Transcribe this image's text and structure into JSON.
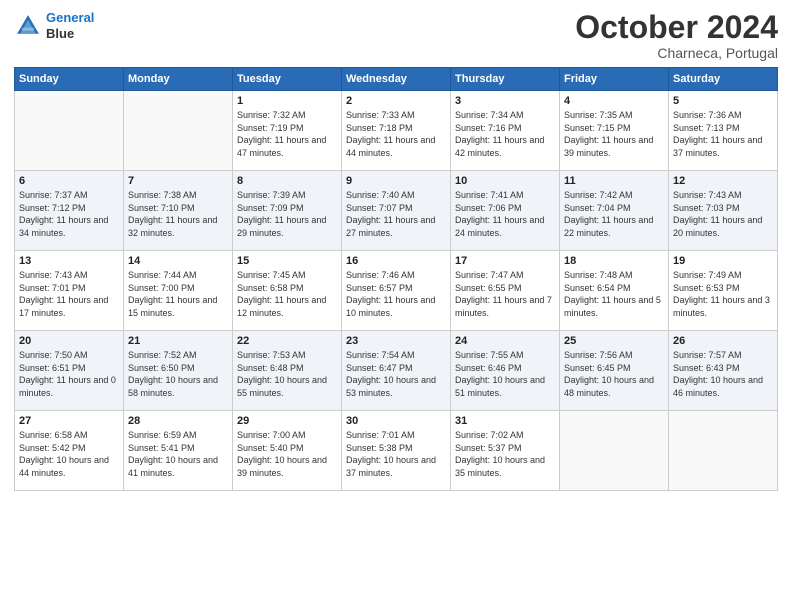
{
  "header": {
    "logo_line1": "General",
    "logo_line2": "Blue",
    "month": "October 2024",
    "location": "Charneca, Portugal"
  },
  "days_of_week": [
    "Sunday",
    "Monday",
    "Tuesday",
    "Wednesday",
    "Thursday",
    "Friday",
    "Saturday"
  ],
  "weeks": [
    [
      {
        "day": "",
        "sunrise": "",
        "sunset": "",
        "daylight": ""
      },
      {
        "day": "",
        "sunrise": "",
        "sunset": "",
        "daylight": ""
      },
      {
        "day": "1",
        "sunrise": "Sunrise: 7:32 AM",
        "sunset": "Sunset: 7:19 PM",
        "daylight": "Daylight: 11 hours and 47 minutes."
      },
      {
        "day": "2",
        "sunrise": "Sunrise: 7:33 AM",
        "sunset": "Sunset: 7:18 PM",
        "daylight": "Daylight: 11 hours and 44 minutes."
      },
      {
        "day": "3",
        "sunrise": "Sunrise: 7:34 AM",
        "sunset": "Sunset: 7:16 PM",
        "daylight": "Daylight: 11 hours and 42 minutes."
      },
      {
        "day": "4",
        "sunrise": "Sunrise: 7:35 AM",
        "sunset": "Sunset: 7:15 PM",
        "daylight": "Daylight: 11 hours and 39 minutes."
      },
      {
        "day": "5",
        "sunrise": "Sunrise: 7:36 AM",
        "sunset": "Sunset: 7:13 PM",
        "daylight": "Daylight: 11 hours and 37 minutes."
      }
    ],
    [
      {
        "day": "6",
        "sunrise": "Sunrise: 7:37 AM",
        "sunset": "Sunset: 7:12 PM",
        "daylight": "Daylight: 11 hours and 34 minutes."
      },
      {
        "day": "7",
        "sunrise": "Sunrise: 7:38 AM",
        "sunset": "Sunset: 7:10 PM",
        "daylight": "Daylight: 11 hours and 32 minutes."
      },
      {
        "day": "8",
        "sunrise": "Sunrise: 7:39 AM",
        "sunset": "Sunset: 7:09 PM",
        "daylight": "Daylight: 11 hours and 29 minutes."
      },
      {
        "day": "9",
        "sunrise": "Sunrise: 7:40 AM",
        "sunset": "Sunset: 7:07 PM",
        "daylight": "Daylight: 11 hours and 27 minutes."
      },
      {
        "day": "10",
        "sunrise": "Sunrise: 7:41 AM",
        "sunset": "Sunset: 7:06 PM",
        "daylight": "Daylight: 11 hours and 24 minutes."
      },
      {
        "day": "11",
        "sunrise": "Sunrise: 7:42 AM",
        "sunset": "Sunset: 7:04 PM",
        "daylight": "Daylight: 11 hours and 22 minutes."
      },
      {
        "day": "12",
        "sunrise": "Sunrise: 7:43 AM",
        "sunset": "Sunset: 7:03 PM",
        "daylight": "Daylight: 11 hours and 20 minutes."
      }
    ],
    [
      {
        "day": "13",
        "sunrise": "Sunrise: 7:43 AM",
        "sunset": "Sunset: 7:01 PM",
        "daylight": "Daylight: 11 hours and 17 minutes."
      },
      {
        "day": "14",
        "sunrise": "Sunrise: 7:44 AM",
        "sunset": "Sunset: 7:00 PM",
        "daylight": "Daylight: 11 hours and 15 minutes."
      },
      {
        "day": "15",
        "sunrise": "Sunrise: 7:45 AM",
        "sunset": "Sunset: 6:58 PM",
        "daylight": "Daylight: 11 hours and 12 minutes."
      },
      {
        "day": "16",
        "sunrise": "Sunrise: 7:46 AM",
        "sunset": "Sunset: 6:57 PM",
        "daylight": "Daylight: 11 hours and 10 minutes."
      },
      {
        "day": "17",
        "sunrise": "Sunrise: 7:47 AM",
        "sunset": "Sunset: 6:55 PM",
        "daylight": "Daylight: 11 hours and 7 minutes."
      },
      {
        "day": "18",
        "sunrise": "Sunrise: 7:48 AM",
        "sunset": "Sunset: 6:54 PM",
        "daylight": "Daylight: 11 hours and 5 minutes."
      },
      {
        "day": "19",
        "sunrise": "Sunrise: 7:49 AM",
        "sunset": "Sunset: 6:53 PM",
        "daylight": "Daylight: 11 hours and 3 minutes."
      }
    ],
    [
      {
        "day": "20",
        "sunrise": "Sunrise: 7:50 AM",
        "sunset": "Sunset: 6:51 PM",
        "daylight": "Daylight: 11 hours and 0 minutes."
      },
      {
        "day": "21",
        "sunrise": "Sunrise: 7:52 AM",
        "sunset": "Sunset: 6:50 PM",
        "daylight": "Daylight: 10 hours and 58 minutes."
      },
      {
        "day": "22",
        "sunrise": "Sunrise: 7:53 AM",
        "sunset": "Sunset: 6:48 PM",
        "daylight": "Daylight: 10 hours and 55 minutes."
      },
      {
        "day": "23",
        "sunrise": "Sunrise: 7:54 AM",
        "sunset": "Sunset: 6:47 PM",
        "daylight": "Daylight: 10 hours and 53 minutes."
      },
      {
        "day": "24",
        "sunrise": "Sunrise: 7:55 AM",
        "sunset": "Sunset: 6:46 PM",
        "daylight": "Daylight: 10 hours and 51 minutes."
      },
      {
        "day": "25",
        "sunrise": "Sunrise: 7:56 AM",
        "sunset": "Sunset: 6:45 PM",
        "daylight": "Daylight: 10 hours and 48 minutes."
      },
      {
        "day": "26",
        "sunrise": "Sunrise: 7:57 AM",
        "sunset": "Sunset: 6:43 PM",
        "daylight": "Daylight: 10 hours and 46 minutes."
      }
    ],
    [
      {
        "day": "27",
        "sunrise": "Sunrise: 6:58 AM",
        "sunset": "Sunset: 5:42 PM",
        "daylight": "Daylight: 10 hours and 44 minutes."
      },
      {
        "day": "28",
        "sunrise": "Sunrise: 6:59 AM",
        "sunset": "Sunset: 5:41 PM",
        "daylight": "Daylight: 10 hours and 41 minutes."
      },
      {
        "day": "29",
        "sunrise": "Sunrise: 7:00 AM",
        "sunset": "Sunset: 5:40 PM",
        "daylight": "Daylight: 10 hours and 39 minutes."
      },
      {
        "day": "30",
        "sunrise": "Sunrise: 7:01 AM",
        "sunset": "Sunset: 5:38 PM",
        "daylight": "Daylight: 10 hours and 37 minutes."
      },
      {
        "day": "31",
        "sunrise": "Sunrise: 7:02 AM",
        "sunset": "Sunset: 5:37 PM",
        "daylight": "Daylight: 10 hours and 35 minutes."
      },
      {
        "day": "",
        "sunrise": "",
        "sunset": "",
        "daylight": ""
      },
      {
        "day": "",
        "sunrise": "",
        "sunset": "",
        "daylight": ""
      }
    ]
  ]
}
